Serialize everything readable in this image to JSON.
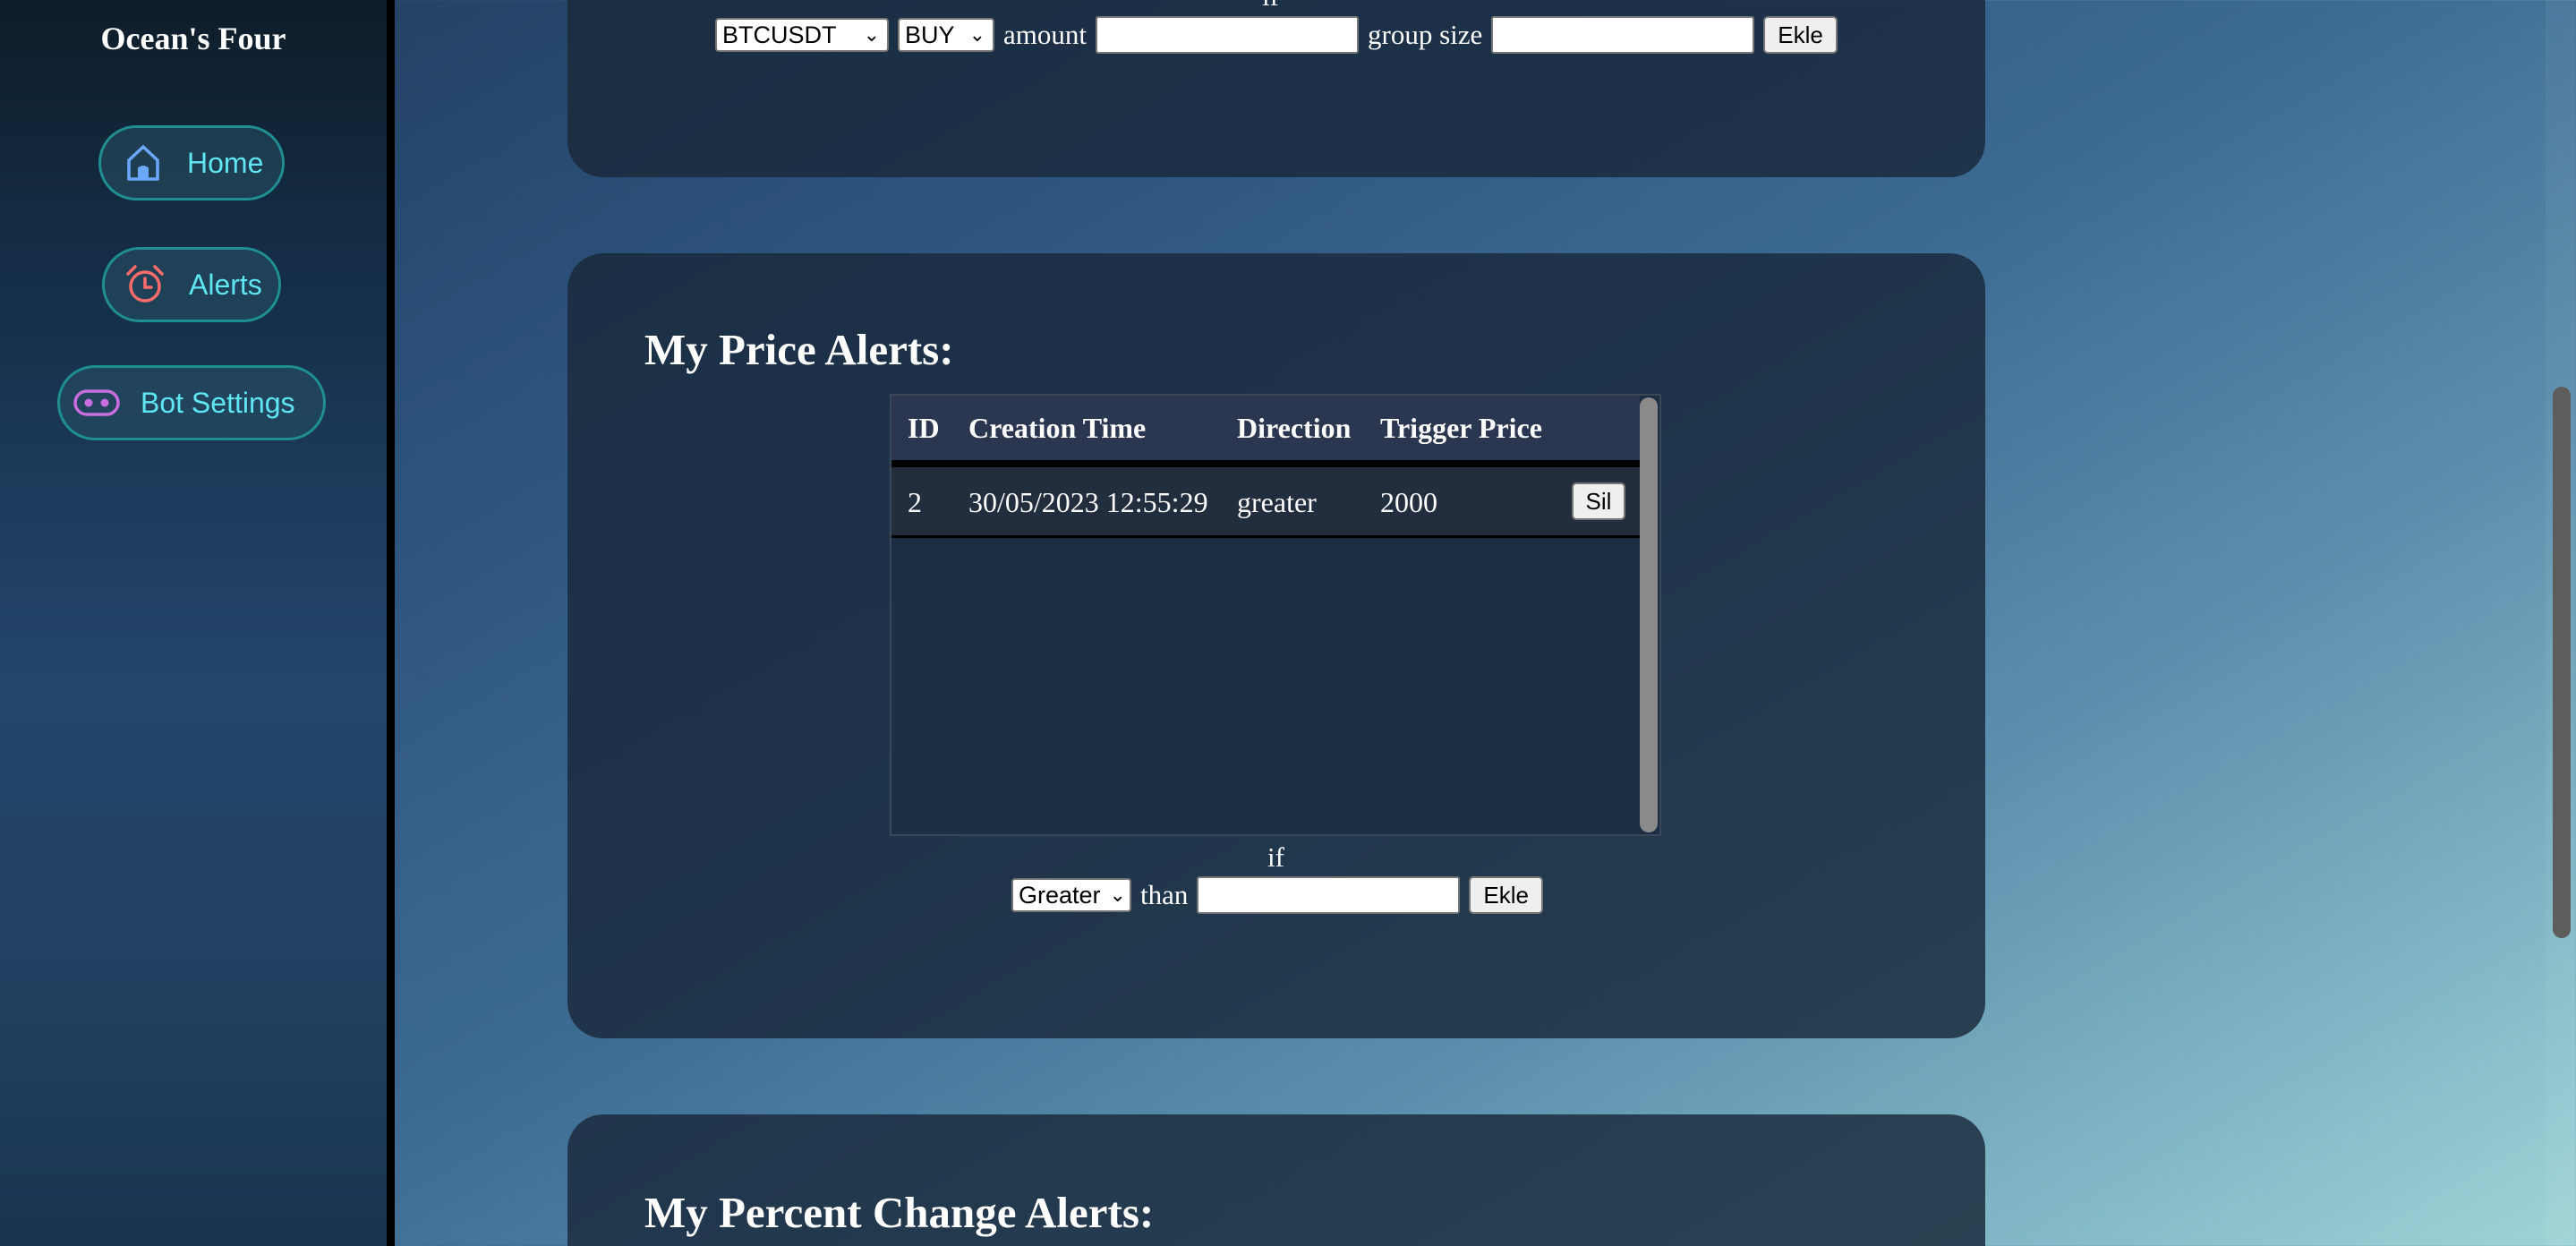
{
  "sidebar": {
    "brand": "Ocean's Four",
    "items": [
      {
        "label": "Home",
        "icon": "home-icon"
      },
      {
        "label": "Alerts",
        "icon": "alarm-clock-icon"
      },
      {
        "label": "Bot Settings",
        "icon": "robot-icon"
      }
    ]
  },
  "colors": {
    "nav_text": "#5ee6f2",
    "nav_border": "#1f8e91",
    "home_icon": "#6aa8ff",
    "alerts_icon": "#ff6b6b",
    "bot_icon": "#c86ee0"
  },
  "bot_form": {
    "if_label": "if",
    "symbol_value": "BTCUSDT",
    "side_value": "BUY",
    "amount_label": "amount",
    "amount_value": "",
    "group_size_label": "group size",
    "group_size_value": "",
    "add_button": "Ekle"
  },
  "price_alerts": {
    "title": "My Price Alerts:",
    "columns": [
      "ID",
      "Creation Time",
      "Direction",
      "Trigger Price"
    ],
    "rows": [
      {
        "id": "2",
        "creation_time": "30/05/2023 12:55:29",
        "direction": "greater",
        "trigger_price": "2000",
        "delete_label": "Sil"
      }
    ],
    "if_label": "if",
    "direction_value": "Greater",
    "than_label": "than",
    "price_value": "",
    "add_button": "Ekle"
  },
  "percent_alerts": {
    "title": "My Percent Change Alerts:"
  }
}
